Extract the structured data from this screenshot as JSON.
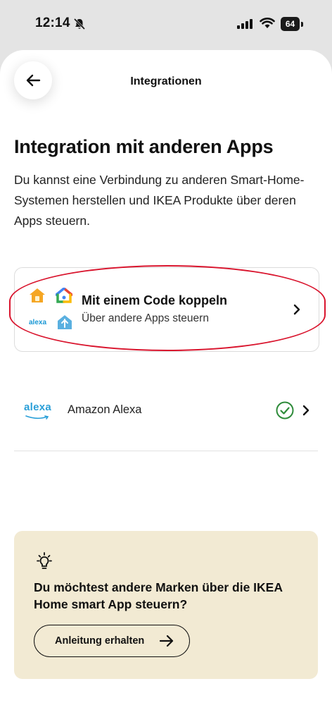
{
  "status_bar": {
    "time": "12:14",
    "battery": "64"
  },
  "header": {
    "title": "Integrationen"
  },
  "main": {
    "title": "Integration mit anderen Apps",
    "description": "Du kannst eine Verbindung zu anderen Smart-Home-Systemen herstellen und IKEA Produkte über deren Apps steuern."
  },
  "code_card": {
    "title": "Mit einem Code koppeln",
    "subtitle": "Über andere Apps steuern",
    "alexa_mini_label": "alexa",
    "icons": [
      "apple-home-icon",
      "google-home-icon",
      "alexa-icon",
      "smartthings-icon",
      "chevron-right-icon"
    ]
  },
  "integrations": [
    {
      "logo_text": "alexa",
      "name": "Amazon Alexa",
      "status": "connected"
    }
  ],
  "tip": {
    "title": "Du möchtest andere Marken über die IKEA Home smart App steuern?",
    "button_label": "Anleitung erhalten"
  },
  "colors": {
    "sheet_bg": "#ffffff",
    "page_bg": "#e4e4e4",
    "tip_bg": "#f2ead3",
    "highlight_oval": "#d9142d",
    "check_green": "#2e8b3a",
    "alexa_blue": "#2a9fd8"
  }
}
